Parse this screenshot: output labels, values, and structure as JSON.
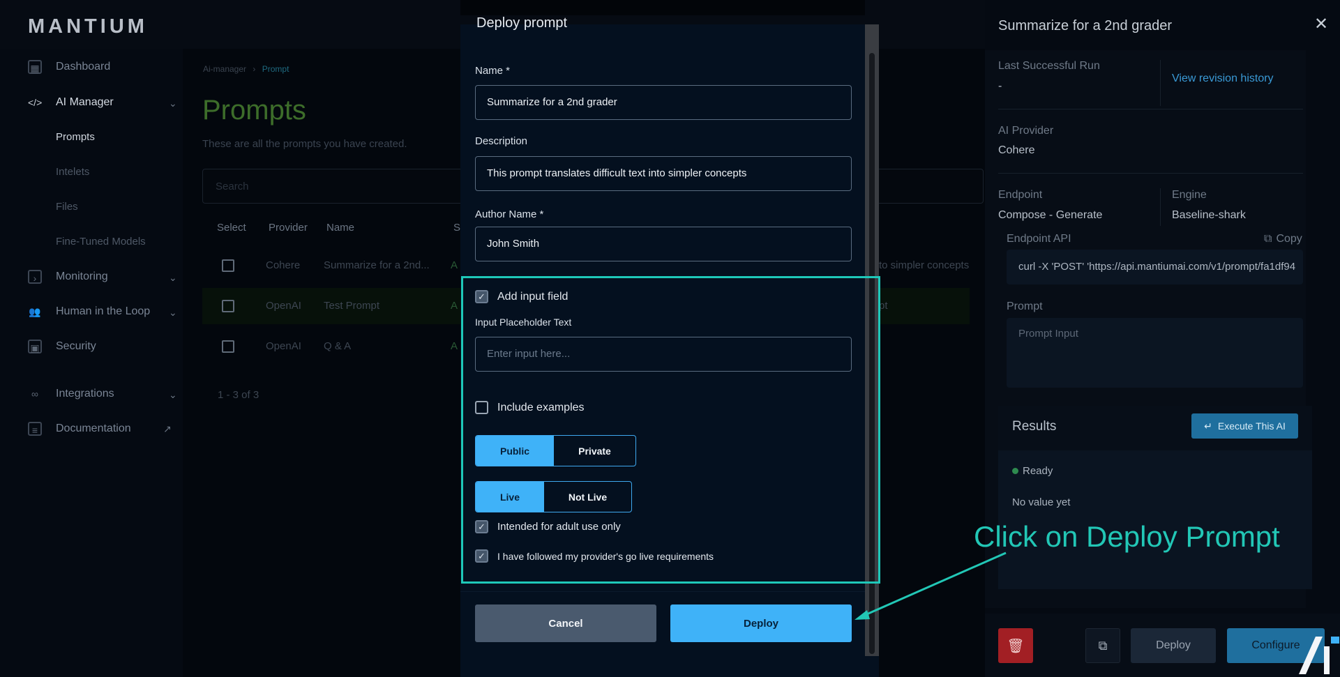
{
  "app": {
    "logo": "MANTIUM",
    "sidebar": {
      "items": [
        {
          "label": "Dashboard",
          "icon": "grid-icon"
        },
        {
          "label": "AI Manager",
          "icon": "code-icon",
          "expanded": true,
          "children": [
            {
              "label": "Prompts",
              "active": true
            },
            {
              "label": "Intelets"
            },
            {
              "label": "Files"
            },
            {
              "label": "Fine-Tuned Models"
            }
          ]
        },
        {
          "label": "Monitoring",
          "icon": "terminal-icon"
        },
        {
          "label": "Human in the Loop",
          "icon": "people-icon"
        },
        {
          "label": "Security",
          "icon": "lock-icon"
        },
        {
          "label": "Integrations",
          "icon": "link-icon"
        },
        {
          "label": "Documentation",
          "icon": "doc-icon"
        }
      ]
    },
    "breadcrumb": [
      "Ai-manager",
      "Prompt"
    ],
    "page_title": "Prompts",
    "page_subtitle": "These are all the prompts you have created.",
    "search_placeholder": "Search",
    "table": {
      "headers": [
        "Select",
        "Provider",
        "Name",
        "S"
      ],
      "rows": [
        {
          "provider": "Cohere",
          "name": "Summarize for a 2nd...",
          "status": "A",
          "extra": "to simpler concepts"
        },
        {
          "provider": "OpenAI",
          "name": "Test Prompt",
          "status": "A",
          "extra": "pt"
        },
        {
          "provider": "OpenAI",
          "name": "Q & A",
          "status": "A",
          "extra": ""
        }
      ],
      "pager": "1 - 3 of 3"
    }
  },
  "dialog": {
    "title": "Deploy prompt",
    "name_label": "Name *",
    "name_value": "Summarize for a 2nd grader",
    "description_label": "Description",
    "description_value": "This prompt translates difficult text into simpler concepts",
    "author_label": "Author Name *",
    "author_value": "John Smith",
    "add_input_label": "Add input field",
    "add_input_checked": true,
    "placeholder_label": "Input Placeholder Text",
    "placeholder_input_placeholder": "Enter input here...",
    "include_examples_label": "Include examples",
    "include_examples_checked": false,
    "visibility": {
      "options": [
        "Public",
        "Private"
      ],
      "selected": "Public"
    },
    "live": {
      "options": [
        "Live",
        "Not Live"
      ],
      "selected": "Live"
    },
    "adult_label": "Intended for adult use only",
    "adult_checked": true,
    "golive_label": "I have followed my provider's go live requirements",
    "golive_checked": true,
    "cancel_label": "Cancel",
    "deploy_label": "Deploy"
  },
  "panel": {
    "title": "Summarize for a 2nd grader",
    "last_run_label": "Last Successful Run",
    "last_run_value": "-",
    "revision_link": "View revision history",
    "provider_label": "AI Provider",
    "provider_value": "Cohere",
    "endpoint_label": "Endpoint",
    "endpoint_value": "Compose - Generate",
    "engine_label": "Engine",
    "engine_value": "Baseline-shark",
    "api_label": "Endpoint API",
    "copy_label": "Copy",
    "api_value": "curl -X 'POST' 'https://api.mantiumai.com/v1/prompt/fa1df94",
    "prompt_label": "Prompt",
    "prompt_placeholder": "Prompt Input",
    "results_title": "Results",
    "execute_label": "Execute This AI",
    "status_text": "Ready",
    "no_value_text": "No value yet",
    "deploy_label": "Deploy",
    "configure_label": "Configure"
  },
  "annotation": {
    "text": "Click on Deploy Prompt",
    "color": "#22c7b6"
  },
  "colors": {
    "accent": "#3fb2f8",
    "highlight": "#1ec8b9",
    "danger": "#a21f24"
  }
}
